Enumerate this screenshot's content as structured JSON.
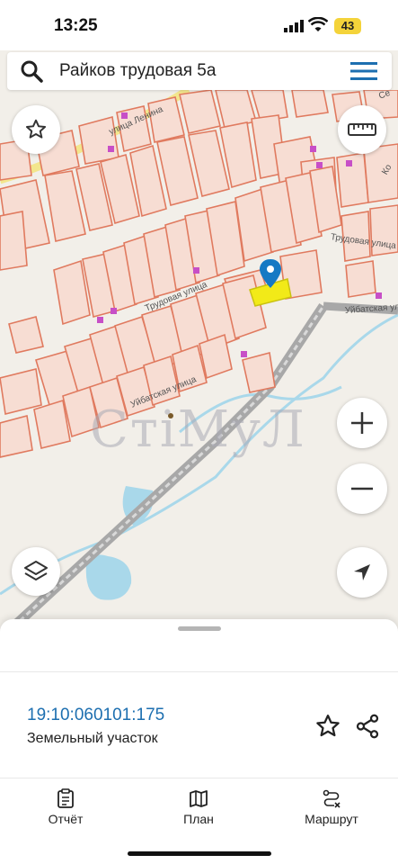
{
  "status": {
    "time": "13:25",
    "battery": "43"
  },
  "search": {
    "query": "Райков трудовая 5а"
  },
  "map": {
    "streets": [
      "улица Ленина",
      "Трудовая улица",
      "Трудовая улица",
      "Уйбатская улица",
      "Уйбатская улица",
      "Се",
      "Ко"
    ],
    "watermark": "СтiМуЛ"
  },
  "card": {
    "parcel_id": "19:10:060101:175",
    "parcel_type": "Земельный участок"
  },
  "tabs": [
    {
      "label": "Отчёт",
      "icon": "clipboard-icon"
    },
    {
      "label": "План",
      "icon": "map-icon"
    },
    {
      "label": "Маршрут",
      "icon": "route-icon"
    }
  ],
  "colors": {
    "accent": "#1d6fb0",
    "parcel_fill": "#f7ddd3",
    "parcel_stroke": "#e07a5f",
    "highlight": "#f2ea18",
    "water": "#a9d8ea",
    "road": "#9a9a9a"
  }
}
